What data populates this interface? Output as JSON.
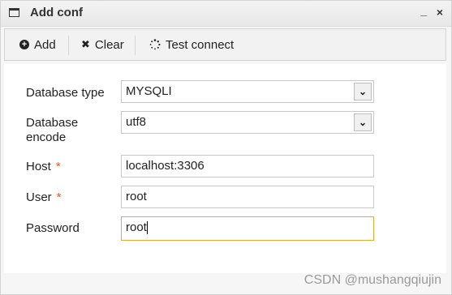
{
  "window": {
    "title": "Add conf",
    "minimize_glyph": "_",
    "close_glyph": "×"
  },
  "toolbar": {
    "add_label": "Add",
    "clear_label": "Clear",
    "test_label": "Test connect"
  },
  "form": {
    "db_type": {
      "label": "Database type",
      "value": "MYSQLI"
    },
    "db_encode": {
      "label": "Database encode",
      "value": "utf8"
    },
    "host": {
      "label": "Host",
      "required": "*",
      "value": "localhost:3306"
    },
    "user": {
      "label": "User",
      "required": "*",
      "value": "root"
    },
    "password": {
      "label": "Password",
      "value": "root"
    }
  },
  "watermark": "CSDN @mushangqiujin",
  "colors": {
    "required": "#e25c2a",
    "focus_border": "#e6a830"
  }
}
